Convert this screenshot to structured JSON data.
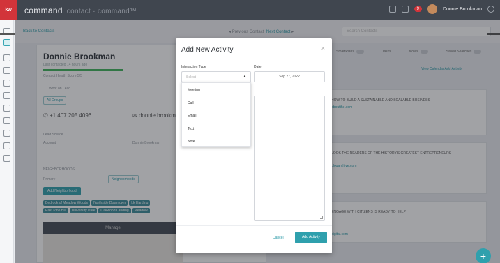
{
  "app": {
    "logo": "kw",
    "title": "command",
    "title_suffix": "contact · command™"
  },
  "header": {
    "notif_count": "9",
    "user_name": "Donnie Brookman"
  },
  "subbar": {
    "back_label": "Back to Contacts",
    "prev_label": "Previous Contact",
    "next_label": "Next Contact",
    "search_placeholder": "Search Contacts"
  },
  "contact": {
    "name": "Donnie Brookman",
    "subtitle": "Last contacted 14 hours ago",
    "status_line": "Contact Health Score 5/5",
    "work_label": "Work on Lead",
    "pill": "All Groups",
    "phone": "+1 407 205 4096",
    "email": "donnie.brookman",
    "lead_source_label": "Lead Source",
    "account_label": "Account",
    "account_value": "Donnie Brookman",
    "neighborhood_label": "NEIGHBORHOODS",
    "primary_label": "Primary",
    "neighborhood_select": "Neighborhoods",
    "add_neighborhood": "Add Neighborhood",
    "chips_row1": [
      "Bedrock of Meadow Woods",
      "Northside Downtown",
      "Lk Harding"
    ],
    "chips_row2": [
      "East Pine Hill",
      "University Park",
      "Oakwood Landing",
      "Meadow"
    ],
    "map_bar": "Manage"
  },
  "right": {
    "tabs": [
      {
        "label": "SmartPlans"
      },
      {
        "label": "Tasks"
      },
      {
        "label": "Notes"
      },
      {
        "label": "Saved Searches"
      }
    ],
    "links": "View Calendar   Add Activity",
    "cards": [
      {
        "title": "HOW TO BUILD A SUSTAINABLE AND SCALABLE BUSINESS",
        "link": "aboutthe.com"
      },
      {
        "title": "LOOK THE READERS OF THE HISTORY'S GREATEST ENTREPRENEURS",
        "link": "blogarchive.com"
      },
      {
        "title": "ENGAGE WITH CITIZENS IS READY TO HELP",
        "link": "digital.com"
      }
    ]
  },
  "modal": {
    "title": "Add New Activity",
    "close": "×",
    "interaction_label": "Interaction Type",
    "select_placeholder": "Select",
    "date_label": "Date",
    "date_value": "Sep 27, 2022",
    "options": [
      "Meeting",
      "Call",
      "Email",
      "Text",
      "Note"
    ],
    "cancel": "Cancel",
    "submit": "Add Activity"
  },
  "fab": "+"
}
